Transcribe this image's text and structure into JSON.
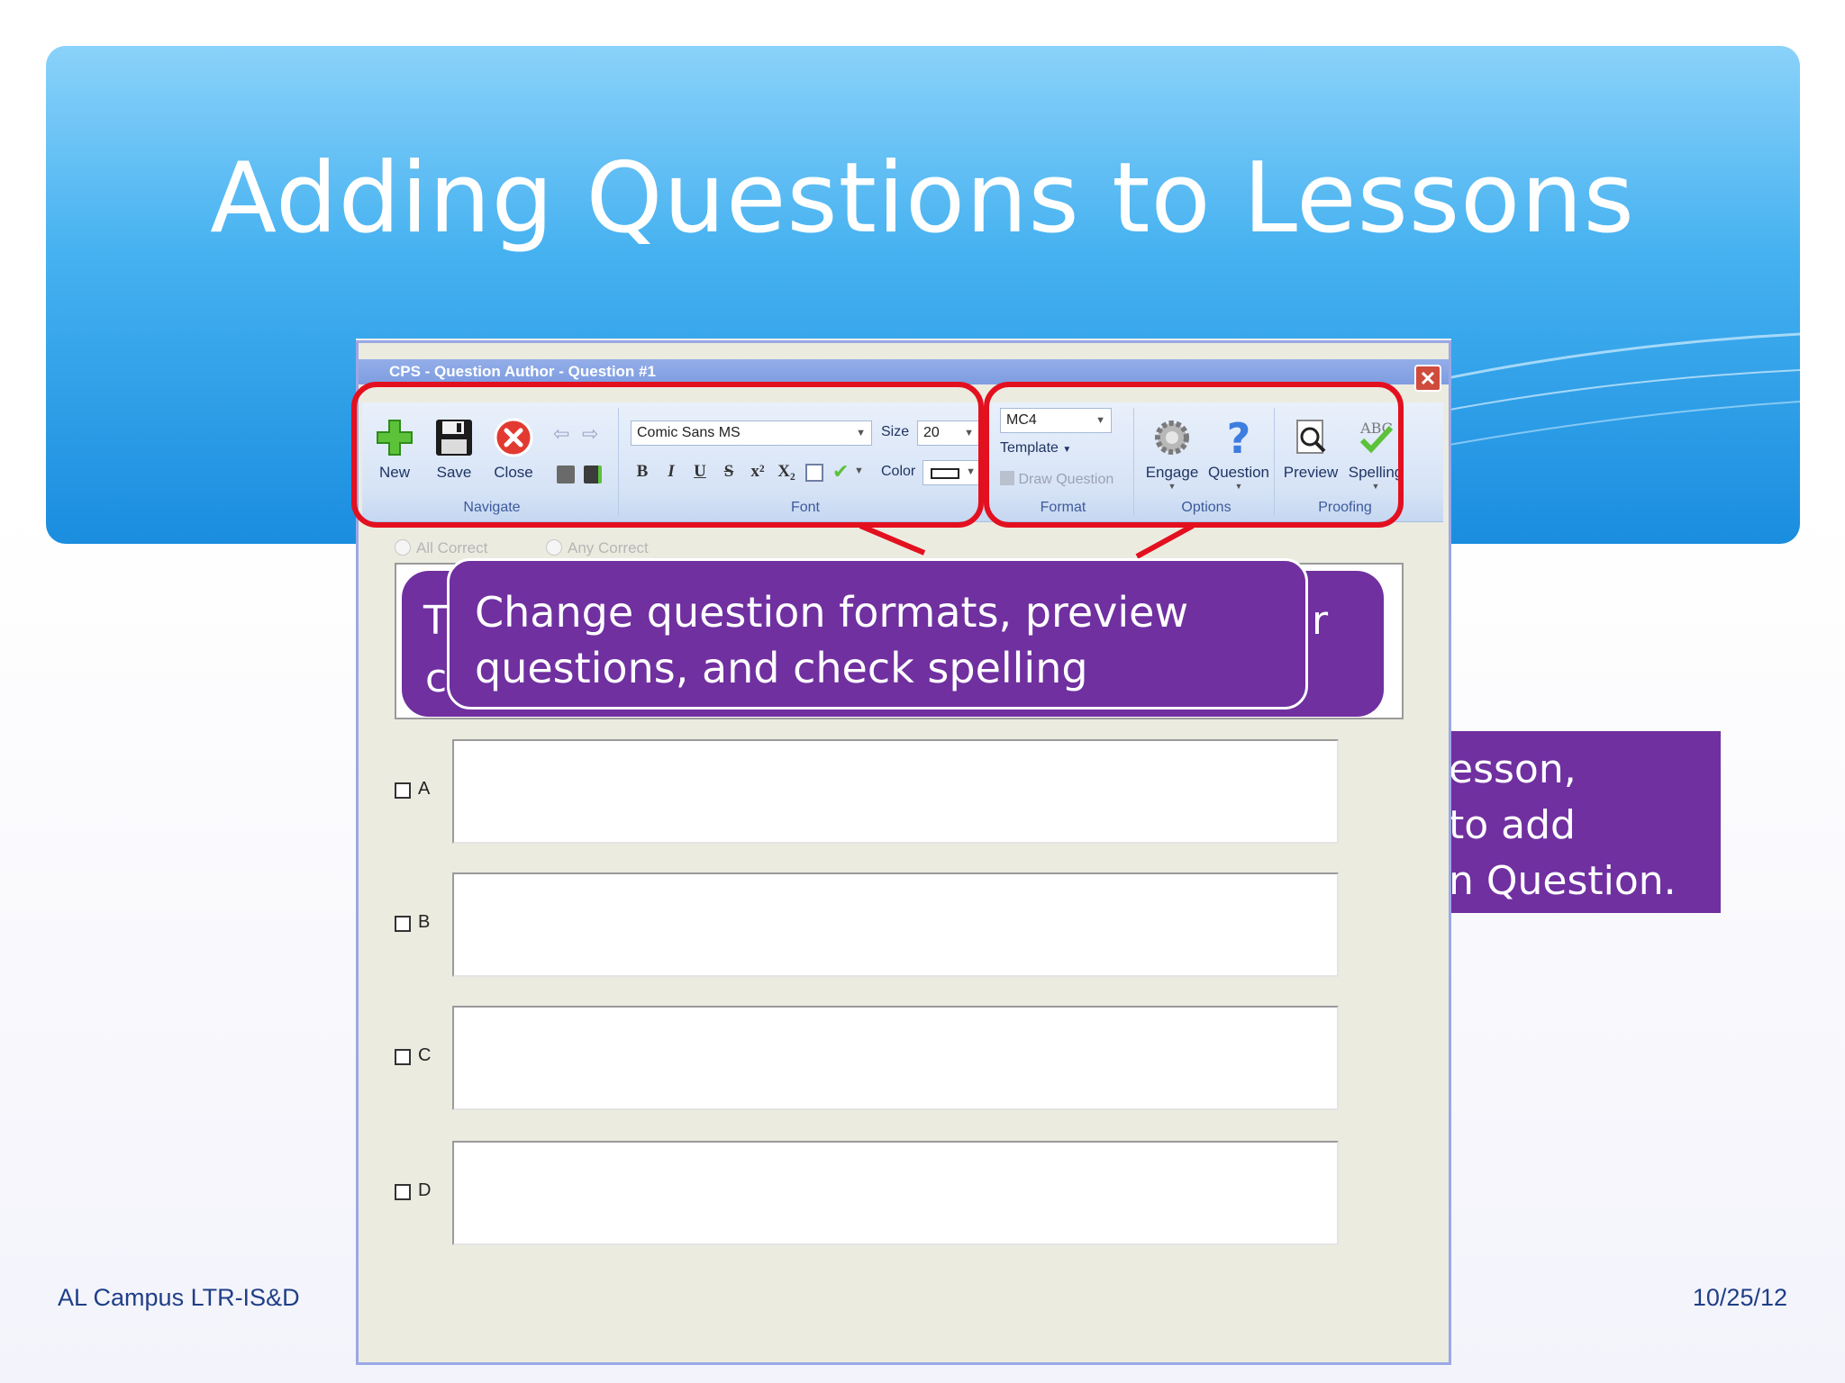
{
  "slide": {
    "title": "Adding Questions to Lessons",
    "footer_left": "AL Campus LTR-IS&D",
    "footer_right": "10/25/12",
    "background_box_lines": [
      "esson,",
      "to add",
      "n Question."
    ]
  },
  "window": {
    "title": "CPS - Question Author - Question #1",
    "close_glyph": "✕"
  },
  "ribbon": {
    "navigate": {
      "label": "Navigate",
      "new": "New",
      "save": "Save",
      "close": "Close"
    },
    "font": {
      "label": "Font",
      "font_name": "Comic Sans MS",
      "size_label": "Size",
      "size_value": "20",
      "color_label": "Color",
      "bold": "B",
      "italic": "I",
      "underline": "U",
      "strike": "S",
      "superscript": "x²",
      "subscript": "X₂"
    },
    "format": {
      "label": "Format",
      "type_value": "MC4",
      "template": "Template",
      "draw_question": "Draw Question"
    },
    "options": {
      "label": "Options",
      "engage": "Engage",
      "question": "Question"
    },
    "proofing": {
      "label": "Proofing",
      "preview": "Preview",
      "spelling": "Spelling",
      "spelling_badge": "ABC"
    }
  },
  "question": {
    "all_correct": "All Correct",
    "any_correct": "Any Correct",
    "answers": [
      "A",
      "B",
      "C",
      "D"
    ]
  },
  "callout": {
    "text": "Change question formats, preview questions, and check spelling",
    "under_left_1": "T",
    "under_left_2": "c",
    "under_right": "r"
  },
  "colors": {
    "accent_purple": "#7030a0",
    "highlight_red": "#e3101f",
    "banner_blue": "#2a9be6"
  }
}
